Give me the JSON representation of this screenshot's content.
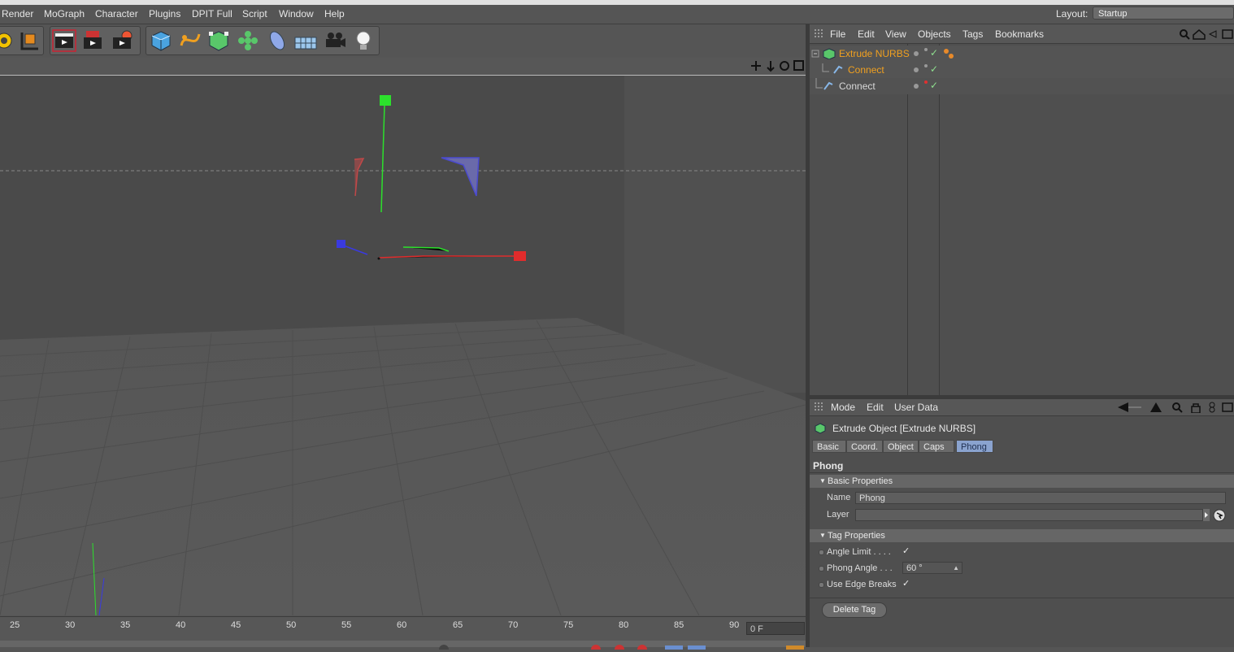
{
  "menubar": {
    "items": [
      "Render",
      "MoGraph",
      "Character",
      "Plugins",
      "DPIT Full",
      "Script",
      "Window",
      "Help"
    ],
    "layout_label": "Layout:",
    "layout_value": "Startup"
  },
  "timeline": {
    "ticks": [
      "25",
      "30",
      "35",
      "40",
      "45",
      "50",
      "55",
      "60",
      "65",
      "70",
      "75",
      "80",
      "85",
      "90"
    ],
    "frame_value": "0 F"
  },
  "object_manager": {
    "menu": [
      "File",
      "Edit",
      "View",
      "Objects",
      "Tags",
      "Bookmarks"
    ],
    "rows": [
      {
        "name": "Extrude NURBS"
      },
      {
        "name": "Connect"
      },
      {
        "name": "Connect"
      }
    ],
    "colors": {
      "selected": "#f0a020",
      "normal": "#d8d8d8"
    }
  },
  "attribute_manager": {
    "menu": [
      "Mode",
      "Edit",
      "User Data"
    ],
    "title": "Extrude Object [Extrude NURBS]",
    "tabs": [
      "Basic",
      "Coord.",
      "Object",
      "Caps",
      "Phong"
    ],
    "active_tab": "Phong",
    "section": "Phong",
    "basic_properties": {
      "header": "Basic Properties",
      "name_label": "Name",
      "name_value": "Phong",
      "layer_label": "Layer",
      "layer_value": ""
    },
    "tag_properties": {
      "header": "Tag Properties",
      "angle_limit_label": "Angle Limit . . . .",
      "angle_limit_checked": "✓",
      "phong_angle_label": "Phong Angle . . .",
      "phong_angle_value": "60 °",
      "use_edge_breaks_label": "Use Edge Breaks",
      "use_edge_breaks_checked": "✓"
    },
    "delete_button": "Delete Tag"
  }
}
